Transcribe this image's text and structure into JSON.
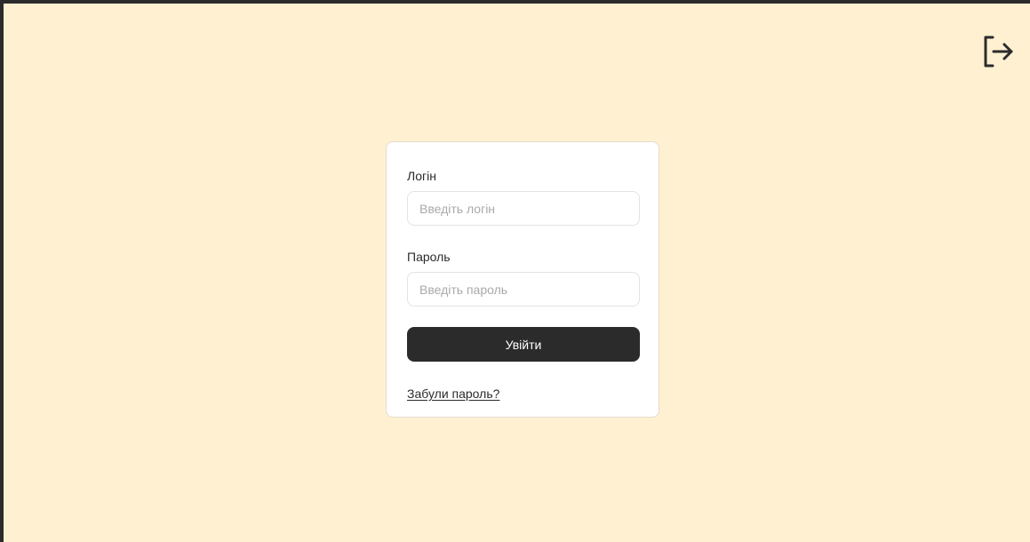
{
  "header": {
    "logout_icon": "logout-icon"
  },
  "login_form": {
    "login_label": "Логін",
    "login_placeholder": "Введіть логін",
    "login_value": "",
    "password_label": "Пароль",
    "password_placeholder": "Введіть пароль",
    "password_value": "",
    "submit_label": "Увійти",
    "forgot_link": "Забули пароль?"
  },
  "colors": {
    "background": "#fff0d2",
    "card": "#ffffff",
    "button": "#2b2b2b",
    "text": "#2b2b2b",
    "placeholder": "#a9a9a9",
    "frame_border": "#2b2b2b"
  }
}
